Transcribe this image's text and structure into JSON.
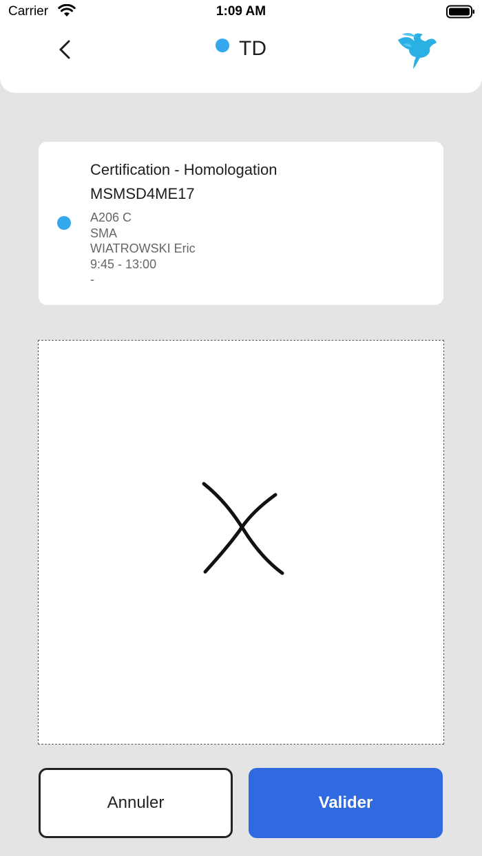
{
  "status_bar": {
    "carrier": "Carrier",
    "time": "1:09 AM"
  },
  "header": {
    "title": "TD",
    "status_color": "#33a8ec",
    "back_icon": "chevron-left-icon",
    "logo_icon": "pegasus-logo-icon"
  },
  "course": {
    "title": "Certification - Homologation",
    "code": "MSMSD4ME17",
    "room": "A206 C",
    "group": "SMA",
    "teacher": "WIATROWSKI Eric",
    "time": "9:45 - 13:00",
    "note": "-",
    "status_color": "#33a8ec"
  },
  "signature": {
    "content": "X signature stroke"
  },
  "actions": {
    "cancel_label": "Annuler",
    "validate_label": "Valider",
    "validate_color": "#2f6ae0"
  }
}
